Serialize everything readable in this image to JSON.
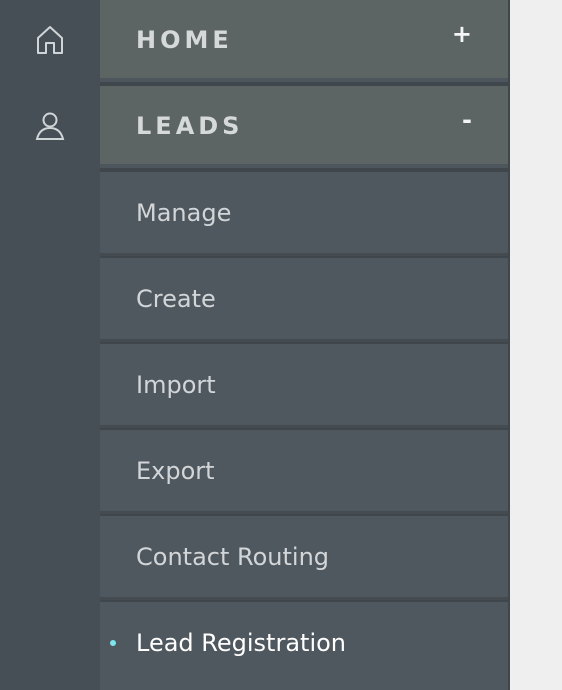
{
  "rail": {
    "icons": [
      "home-icon",
      "user-icon"
    ]
  },
  "menu": {
    "sections": [
      {
        "label": "HOME",
        "toggle": "+",
        "expanded": false
      },
      {
        "label": "LEADS",
        "toggle": "-",
        "expanded": true
      }
    ],
    "leads_items": [
      {
        "label": "Manage",
        "active": false
      },
      {
        "label": "Create",
        "active": false
      },
      {
        "label": "Import",
        "active": false
      },
      {
        "label": "Export",
        "active": false
      },
      {
        "label": "Contact Routing",
        "active": false
      },
      {
        "label": "Lead Registration",
        "active": true
      }
    ]
  },
  "colors": {
    "rail_bg": "#464f56",
    "section_bg": "#5d6564",
    "item_bg": "#4f585f",
    "active_dot": "#7fe5ec",
    "page_bg": "#efefef"
  }
}
